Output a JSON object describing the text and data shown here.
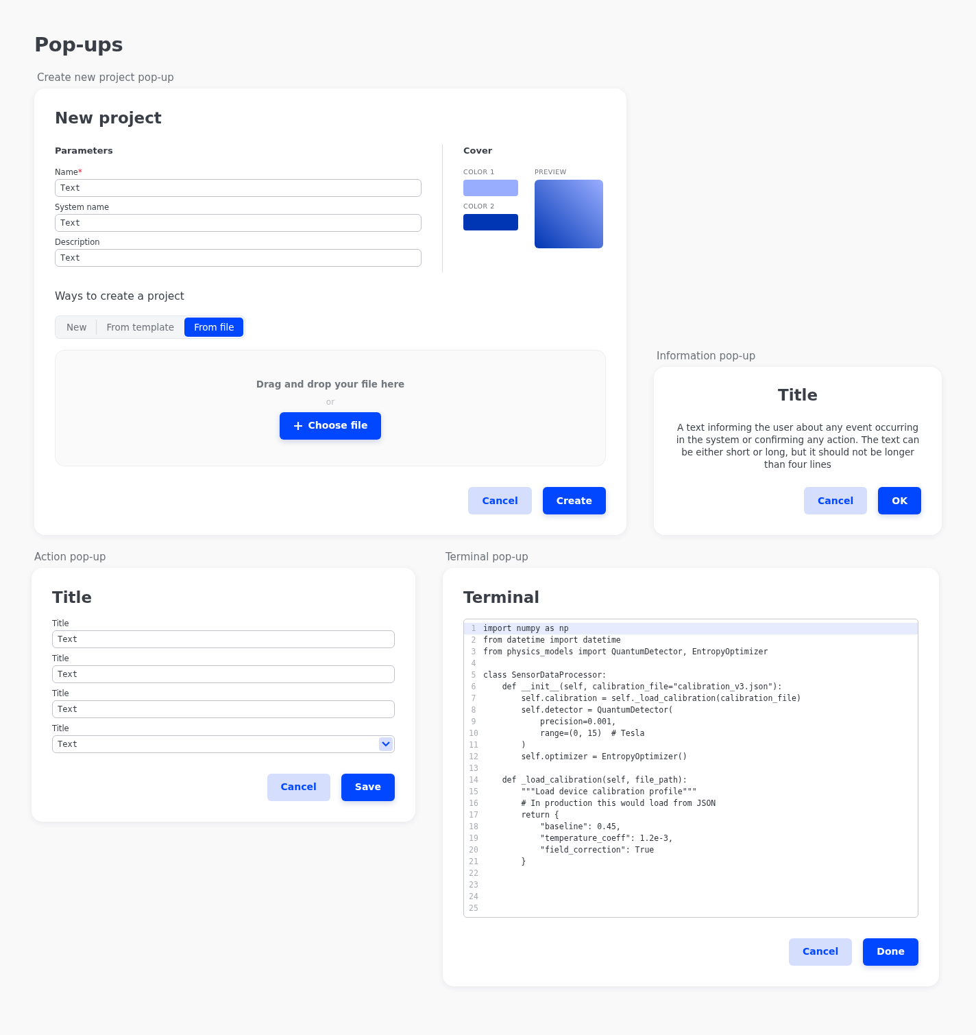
{
  "page_title": "Pop-ups",
  "new_project": {
    "caption": "Create new project pop-up",
    "title": "New project",
    "parameters": {
      "heading": "Parameters",
      "fields": [
        {
          "label": "Name",
          "required_mark": "*",
          "value": "Text"
        },
        {
          "label": "System name",
          "value": "Text"
        },
        {
          "label": "Description",
          "value": "Text"
        }
      ]
    },
    "cover": {
      "heading": "Cover",
      "colors": [
        {
          "label": "COLOR 1",
          "color": "#99adff"
        },
        {
          "label": "COLOR 2",
          "color": "#0036b3"
        }
      ],
      "preview_label": "PREVIEW"
    },
    "ways": {
      "heading": "Ways to create a project",
      "options": [
        {
          "label": "New",
          "selected": false
        },
        {
          "label": "From template",
          "selected": false
        },
        {
          "label": "From file",
          "selected": true
        }
      ]
    },
    "dropzone": {
      "text": "Drag and drop your file here",
      "or": "or",
      "button": "Choose file"
    },
    "buttons": [
      {
        "label": "Cancel",
        "kind": "secondary"
      },
      {
        "label": "Create",
        "kind": "primary"
      }
    ]
  },
  "information": {
    "caption": "Information pop-up",
    "title": "Title",
    "text": "A text informing the user about any event occurring in the system or confirming any action. The text can be either short or long, but it should not be longer than four lines",
    "buttons": [
      {
        "label": "Cancel",
        "kind": "secondary"
      },
      {
        "label": "OK",
        "kind": "primary"
      }
    ]
  },
  "action": {
    "caption": "Action pop-up",
    "title": "Title",
    "fields": [
      {
        "label": "Title",
        "value": "Text",
        "kind": "text"
      },
      {
        "label": "Title",
        "value": "Text",
        "kind": "text"
      },
      {
        "label": "Title",
        "value": "Text",
        "kind": "text"
      },
      {
        "label": "Title",
        "value": "Text",
        "kind": "select"
      }
    ],
    "buttons": [
      {
        "label": "Cancel",
        "kind": "secondary"
      },
      {
        "label": "Save",
        "kind": "primary"
      }
    ]
  },
  "terminal": {
    "caption": "Terminal pop-up",
    "title": "Terminal",
    "lines": [
      {
        "number": "1",
        "code": "import numpy as np",
        "current": true
      },
      {
        "number": "2",
        "code": "from datetime import datetime",
        "current": false
      },
      {
        "number": "3",
        "code": "from physics_models import QuantumDetector, EntropyOptimizer",
        "current": false
      },
      {
        "number": "4",
        "current": false
      },
      {
        "number": "5",
        "code": "class SensorDataProcessor:",
        "current": false
      },
      {
        "number": "6",
        "code": "    def __init__(self, calibration_file=\"calibration_v3.json\"):",
        "current": false
      },
      {
        "number": "7",
        "code": "        self.calibration = self._load_calibration(calibration_file)",
        "current": false
      },
      {
        "number": "8",
        "code": "        self.detector = QuantumDetector(",
        "current": false
      },
      {
        "number": "9",
        "code": "            precision=0.001,",
        "current": false
      },
      {
        "number": "10",
        "code": "            range=(0, 15)  # Tesla",
        "current": false
      },
      {
        "number": "11",
        "code": "        )",
        "current": false
      },
      {
        "number": "12",
        "code": "        self.optimizer = EntropyOptimizer()",
        "current": false
      },
      {
        "number": "13",
        "current": false
      },
      {
        "number": "14",
        "code": "    def _load_calibration(self, file_path):",
        "current": false
      },
      {
        "number": "15",
        "code": "        \"\"\"Load device calibration profile\"\"\"",
        "current": false
      },
      {
        "number": "16",
        "code": "        # In production this would load from JSON",
        "current": false
      },
      {
        "number": "17",
        "code": "        return {",
        "current": false
      },
      {
        "number": "18",
        "code": "            \"baseline\": 0.45,",
        "current": false
      },
      {
        "number": "19",
        "code": "            \"temperature_coeff\": 1.2e-3,",
        "current": false
      },
      {
        "number": "20",
        "code": "            \"field_correction\": True",
        "current": false
      },
      {
        "number": "21",
        "code": "        }",
        "current": false
      },
      {
        "number": "22",
        "current": false
      },
      {
        "number": "23",
        "current": false
      },
      {
        "number": "24",
        "current": false
      },
      {
        "number": "25",
        "current": false
      }
    ],
    "buttons": [
      {
        "label": "Cancel",
        "kind": "secondary"
      },
      {
        "label": "Done",
        "kind": "primary"
      }
    ]
  }
}
